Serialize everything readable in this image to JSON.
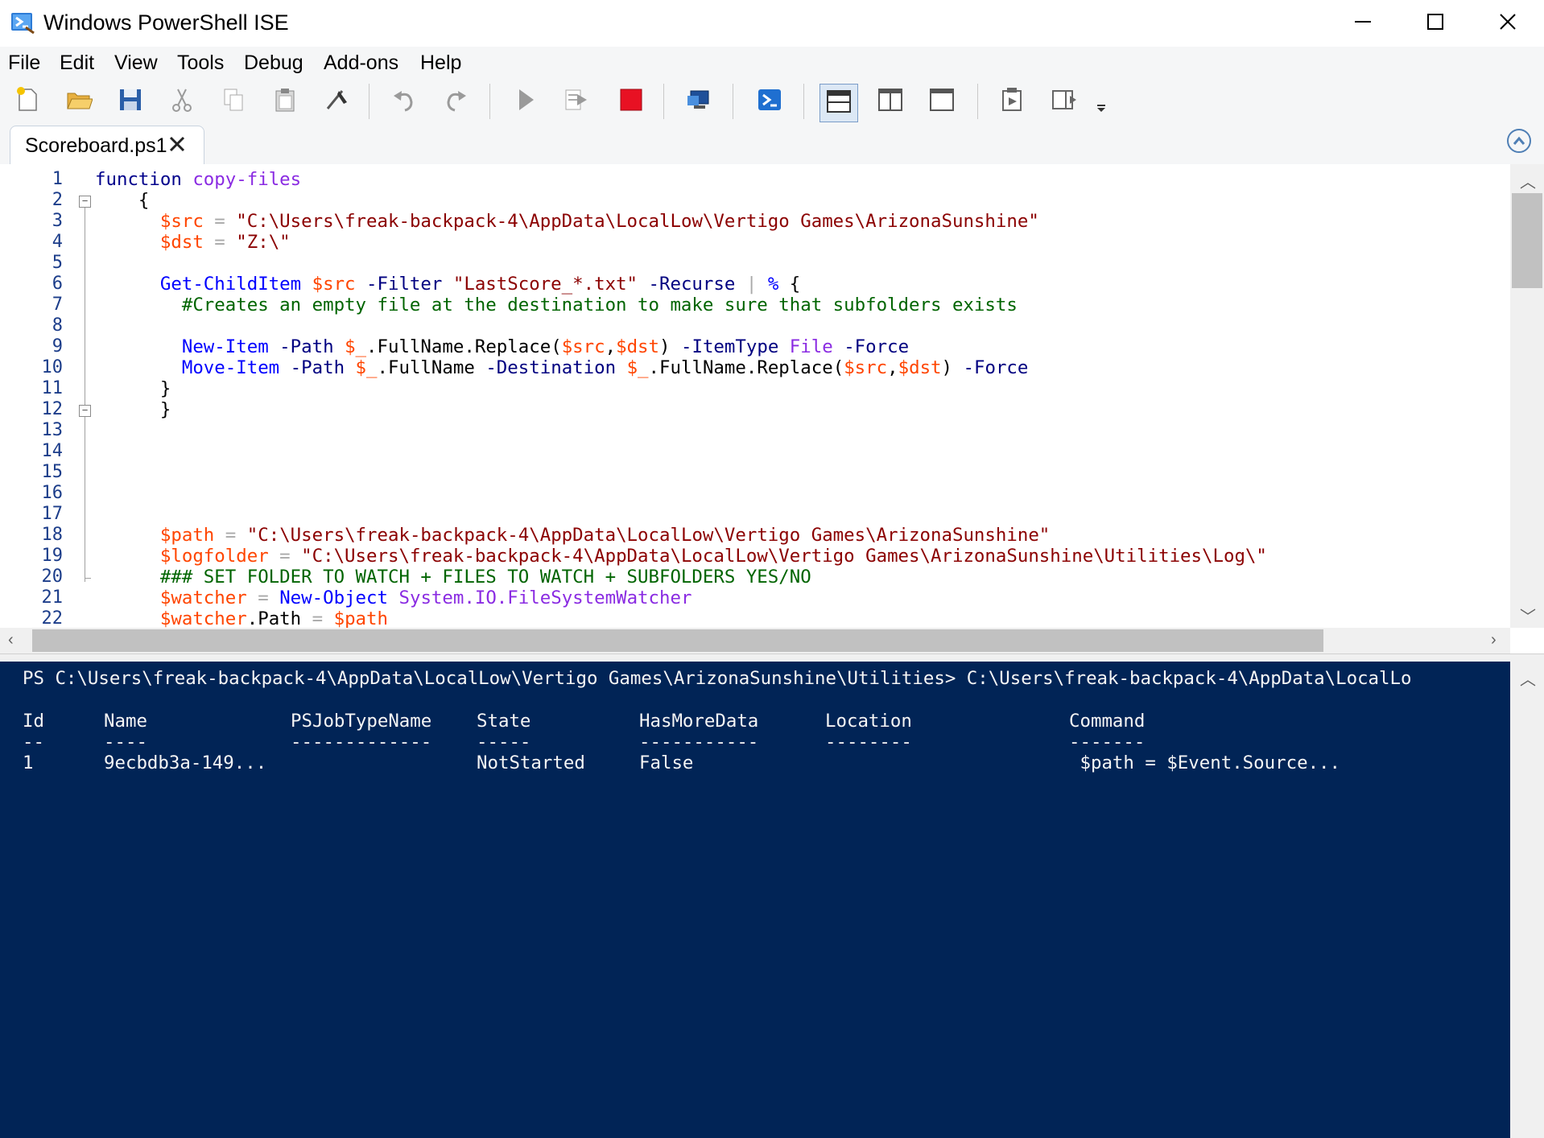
{
  "window": {
    "title": "Windows PowerShell ISE",
    "controls": [
      "minimize-icon",
      "maximize-icon",
      "close-icon"
    ]
  },
  "menu": [
    "File",
    "Edit",
    "View",
    "Tools",
    "Debug",
    "Add-ons",
    "Help"
  ],
  "toolbar": [
    "new-file-icon",
    "open-folder-icon",
    "save-icon",
    "cut-icon",
    "copy-icon",
    "paste-icon",
    "clear-console-icon",
    "undo-icon",
    "redo-icon",
    "run-script-icon",
    "run-selection-icon",
    "stop-icon",
    "remote-powershell-tab-icon",
    "powershell-console-icon",
    "show-script-pane-top-icon",
    "show-script-pane-right-icon",
    "show-script-pane-maximized-icon",
    "show-command-window-icon",
    "show-command-addon-icon",
    "toolbar-overflow-icon"
  ],
  "tab": {
    "label": "Scoreboard.ps1"
  },
  "editor": {
    "line_numbers": [
      "1",
      "2",
      "3",
      "4",
      "5",
      "6",
      "7",
      "8",
      "9",
      "10",
      "11",
      "12",
      "13",
      "14",
      "15",
      "16",
      "17",
      "18",
      "19",
      "20",
      "21",
      "22"
    ],
    "lines": [
      [
        [
          "kw",
          "function "
        ],
        [
          "fn",
          "copy-files"
        ]
      ],
      [
        [
          "grp",
          "    {"
        ]
      ],
      [
        [
          "var",
          "      $src"
        ],
        [
          "op",
          " = "
        ],
        [
          "str",
          "\"C:\\Users\\freak-backpack-4\\AppData\\LocalLow\\Vertigo Games\\ArizonaSunshine\""
        ]
      ],
      [
        [
          "var",
          "      $dst"
        ],
        [
          "op",
          " = "
        ],
        [
          "str",
          "\"Z:\\\""
        ]
      ],
      [],
      [
        [
          "cmd",
          "      Get-ChildItem "
        ],
        [
          "var",
          "$src "
        ],
        [
          "par",
          "-Filter "
        ],
        [
          "str",
          "\"LastScore_*.txt\" "
        ],
        [
          "par",
          "-Recurse "
        ],
        [
          "op",
          "| "
        ],
        [
          "cmd",
          "% "
        ],
        [
          "grp",
          "{"
        ]
      ],
      [
        [
          "com",
          "        #Creates an empty file at the destination to make sure that subfolders exists"
        ]
      ],
      [],
      [
        [
          "cmd",
          "        New-Item "
        ],
        [
          "par",
          "-Path "
        ],
        [
          "var",
          "$_"
        ],
        [
          "grp",
          ".FullName.Replace("
        ],
        [
          "var",
          "$src"
        ],
        [
          "grp",
          ","
        ],
        [
          "var",
          "$dst"
        ],
        [
          "grp",
          ") "
        ],
        [
          "par",
          "-ItemType "
        ],
        [
          "fn",
          "File "
        ],
        [
          "par",
          "-Force"
        ]
      ],
      [
        [
          "cmd",
          "        Move-Item "
        ],
        [
          "par",
          "-Path "
        ],
        [
          "var",
          "$_"
        ],
        [
          "grp",
          ".FullName "
        ],
        [
          "par",
          "-Destination "
        ],
        [
          "var",
          "$_"
        ],
        [
          "grp",
          ".FullName.Replace("
        ],
        [
          "var",
          "$src"
        ],
        [
          "grp",
          ","
        ],
        [
          "var",
          "$dst"
        ],
        [
          "grp",
          ") "
        ],
        [
          "par",
          "-Force"
        ]
      ],
      [
        [
          "grp",
          "      }"
        ]
      ],
      [
        [
          "grp",
          "      }"
        ]
      ],
      [],
      [],
      [],
      [],
      [],
      [
        [
          "var",
          "      $path"
        ],
        [
          "op",
          " = "
        ],
        [
          "str",
          "\"C:\\Users\\freak-backpack-4\\AppData\\LocalLow\\Vertigo Games\\ArizonaSunshine\""
        ]
      ],
      [
        [
          "var",
          "      $logfolder"
        ],
        [
          "op",
          " = "
        ],
        [
          "str",
          "\"C:\\Users\\freak-backpack-4\\AppData\\LocalLow\\Vertigo Games\\ArizonaSunshine\\Utilities\\Log\\\""
        ]
      ],
      [
        [
          "com",
          "      ### SET FOLDER TO WATCH + FILES TO WATCH + SUBFOLDERS YES/NO"
        ]
      ],
      [
        [
          "var",
          "      $watcher"
        ],
        [
          "op",
          " = "
        ],
        [
          "cmd",
          "New-Object "
        ],
        [
          "fn",
          "System.IO.FileSystemWatcher"
        ]
      ],
      [
        [
          "var",
          "      $watcher"
        ],
        [
          "grp",
          ".Path "
        ],
        [
          "op",
          "= "
        ],
        [
          "var",
          "$path"
        ]
      ]
    ]
  },
  "console": {
    "prompt": "PS C:\\Users\\freak-backpack-4\\AppData\\LocalLow\\Vertigo Games\\ArizonaSunshine\\Utilities> C:\\Users\\freak-backpack-4\\AppData\\LocalLo",
    "columns": [
      "Id",
      "Name",
      "PSJobTypeName",
      "State",
      "HasMoreData",
      "Location",
      "Command"
    ],
    "separators": [
      "--",
      "----",
      "-------------",
      "-----",
      "-----------",
      "--------",
      "-------"
    ],
    "rows": [
      [
        "1",
        "9ecbdb3a-149...",
        "",
        "NotStarted",
        "False",
        "",
        " $path = $Event.Source..."
      ]
    ]
  },
  "colors": {
    "console_bg": "#012456",
    "keyword": "#00008b",
    "variable": "#ff4500",
    "string": "#8b0000",
    "command": "#0000ff",
    "comment": "#006400",
    "line_number": "#1c3d8a"
  }
}
